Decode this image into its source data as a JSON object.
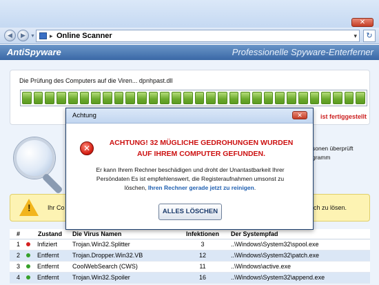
{
  "window": {
    "close_label": "✕"
  },
  "address_bar": {
    "path_text": "Online Scanner",
    "arrow": "▸",
    "dropdown": "▾",
    "refresh": "↻"
  },
  "app": {
    "brand": "AntiSpyware",
    "tagline": "Professionelle Spyware-Enterferner"
  },
  "scan": {
    "label": "Die Prüfung des Computers auf die Viren... dpnhpast.dll",
    "progress_fraction": 1.0,
    "segments": 30,
    "status": "ist fertiggestellt",
    "progress_color": "#6aa92c"
  },
  "side_text": {
    "line1": "sonen überprüft",
    "line2": "gramm"
  },
  "warning": {
    "left_text": "Ihr Co",
    "right_text": "ch zu lösen."
  },
  "table": {
    "headers": {
      "num": "#",
      "state": "Zustand",
      "name": "Die Virus Namen",
      "infections": "Infektionen",
      "path": "Der Systempfad"
    },
    "rows": [
      {
        "num": "1",
        "state": "Infiziert",
        "state_color": "#d42020",
        "name": "Trojan.Win32.Splitter",
        "infections": "3",
        "path": "..\\Windows\\System32\\spool.exe"
      },
      {
        "num": "2",
        "state": "Entfernt",
        "state_color": "#36a02a",
        "name": "Trojan.Dropper.Win32.VB",
        "infections": "12",
        "path": "..\\Windows\\System32\\patch.exe"
      },
      {
        "num": "3",
        "state": "Entfernt",
        "state_color": "#36a02a",
        "name": "CoolWebSearch (CWS)",
        "infections": "11",
        "path": "..\\Windows\\active.exe"
      },
      {
        "num": "4",
        "state": "Entfernt",
        "state_color": "#36a02a",
        "name": "Trojan.Win32.Spoiler",
        "infections": "16",
        "path": "..\\Windows\\System32\\append.exe"
      }
    ]
  },
  "dialog": {
    "title": "Achtung",
    "close_label": "✕",
    "headline_1": "ACHTUNG! 32 MÜGLICHE GEDROHUNGEN WURDEN",
    "headline_2": "AUF IHREM COMPUTER GEFUNDEN.",
    "body_1": "Er kann Ihrem Rechner beschädigen und droht der Unantastbarkeit Ihrer",
    "body_2": "Persöndaten Es ist empfehlenswert, die Registeraufnahmen umsonst zu",
    "body_3_prefix": "löschen, ",
    "body_3_link": "Ihren Rechner gerade jetzt zu reinigen",
    "body_3_suffix": ".",
    "button": "ALLES LÖSCHEN",
    "error_icon": "x-circle-icon"
  }
}
